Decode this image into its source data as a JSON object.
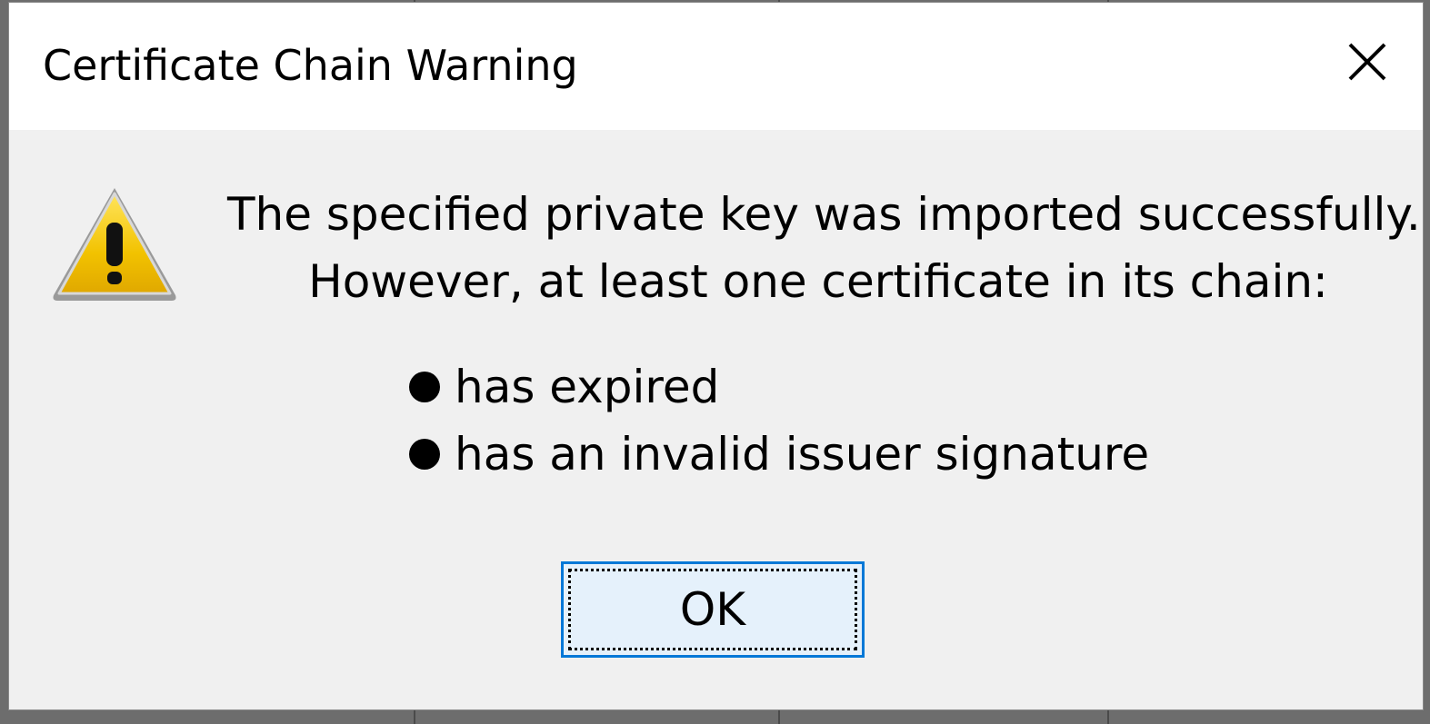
{
  "dialog": {
    "title": "Certificate Chain Warning",
    "close_icon": "close-icon",
    "warning_icon": "warning-icon",
    "message_lines": [
      "The specified private key was imported successfully.",
      "However, at least one certificate in its chain:"
    ],
    "issues": [
      "has expired",
      "has an invalid issuer signature"
    ],
    "ok_label": "OK",
    "colors": {
      "focus_border": "#0078d7",
      "button_fill": "#e5f1fb",
      "dialog_bg": "#f0f0f0",
      "titlebar_bg": "#ffffff",
      "warning_yellow": "#f2c200"
    }
  }
}
